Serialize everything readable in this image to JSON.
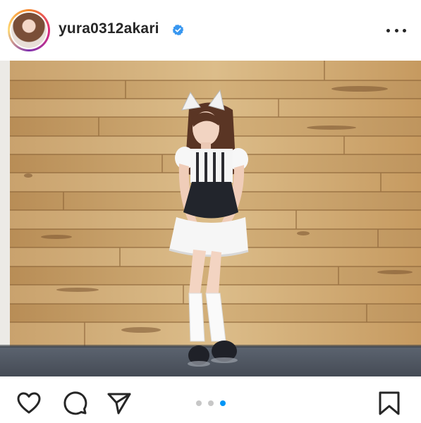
{
  "post": {
    "username": "yura0312akari",
    "verified": true,
    "avatar_icon": "profile-avatar",
    "more_icon": "more-horizontal-icon"
  },
  "carousel": {
    "total": 3,
    "active_index": 2
  },
  "actions": {
    "like_icon": "heart-icon",
    "comment_icon": "comment-icon",
    "share_icon": "send-icon",
    "save_icon": "bookmark-icon"
  },
  "colors": {
    "accent": "#0095f6",
    "text": "#262626",
    "dot_inactive": "#c7c7c7"
  }
}
